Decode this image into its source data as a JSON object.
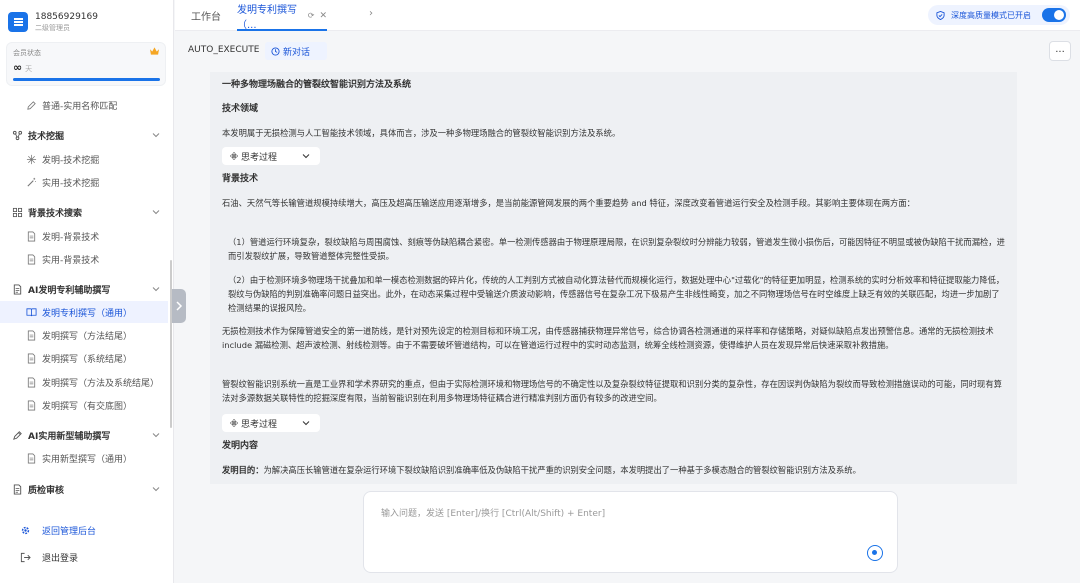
{
  "user": {
    "phone": "18856929169",
    "role": "二级管理员"
  },
  "member": {
    "label": "会员状态",
    "value": "∞",
    "unit": "天",
    "progress": 1.0
  },
  "nav": {
    "items": [
      {
        "type": "s",
        "label": "普通-实用名称匹配",
        "icon": "pencil-icon",
        "name": "sidebar-item-name-match"
      },
      {
        "type": "g",
        "label": "技术挖掘",
        "icon": "network-icon",
        "name": "sidebar-group-tech-mining",
        "chevron": true
      },
      {
        "type": "s",
        "label": "发明-技术挖掘",
        "icon": "sparkle-icon",
        "name": "sidebar-item-invention-mining"
      },
      {
        "type": "s",
        "label": "实用-技术挖掘",
        "icon": "wand-icon",
        "name": "sidebar-item-utility-mining"
      },
      {
        "type": "g",
        "label": "背景技术搜索",
        "icon": "grid-icon",
        "name": "sidebar-group-background",
        "chevron": true
      },
      {
        "type": "s",
        "label": "发明-背景技术",
        "icon": "document-icon",
        "name": "sidebar-item-invention-background"
      },
      {
        "type": "s",
        "label": "实用-背景技术",
        "icon": "document-icon",
        "name": "sidebar-item-utility-background"
      },
      {
        "type": "g",
        "label": "AI发明专利辅助撰写",
        "icon": "file-icon",
        "name": "sidebar-group-ai-invention",
        "chevron": true
      },
      {
        "type": "s",
        "label": "发明专利撰写（通用）",
        "icon": "book-icon",
        "name": "sidebar-item-invention-general",
        "active": true
      },
      {
        "type": "s",
        "label": "发明撰写（方法结尾）",
        "icon": "document-icon",
        "name": "sidebar-item-invention-method"
      },
      {
        "type": "s",
        "label": "发明撰写（系统结尾）",
        "icon": "document-icon",
        "name": "sidebar-item-invention-system"
      },
      {
        "type": "s",
        "label": "发明撰写（方法及系统结尾）",
        "icon": "document-icon",
        "name": "sidebar-item-invention-method-system"
      },
      {
        "type": "s",
        "label": "发明撰写（有交底图）",
        "icon": "document-icon",
        "name": "sidebar-item-invention-diagram"
      },
      {
        "type": "g",
        "label": "AI实用新型辅助撰写",
        "icon": "pen-icon",
        "name": "sidebar-group-ai-utility",
        "chevron": true
      },
      {
        "type": "s",
        "label": "实用新型撰写（通用）",
        "icon": "document-icon",
        "name": "sidebar-item-utility-general"
      },
      {
        "type": "g",
        "label": "质检审核",
        "icon": "file-icon",
        "name": "sidebar-group-quality",
        "chevron": true
      }
    ]
  },
  "bottom": {
    "admin": "返回管理后台",
    "logout": "退出登录"
  },
  "topbar": {
    "tab_home": "工作台",
    "tab_active": "发明专利撰写（...",
    "deep_mode": "深度高质量模式已开启"
  },
  "toolbar": {
    "mode": "AUTO_EXECUTE",
    "new_chat": "新对话",
    "more": "..."
  },
  "doc": {
    "title": "一种多物理场融合的管裂纹智能识别方法及系统",
    "h_field": "技术领域",
    "field": "本发明属于无损检测与人工智能技术领域，具体而言，涉及一种多物理场融合的管裂纹智能识别方法及系统。",
    "thinking": "思考过程",
    "h_background": "背景技术",
    "bg1": "石油、天然气等长输管道规模持续增大，高压及超高压输送应用逐渐增多，是当前能源管网发展的两个重要趋势 and 特征，深度改变着管道运行安全及检测手段。其影响主要体现在两方面：",
    "bg2": "（1）管道运行环境复杂，裂纹缺陷与周围腐蚀、刻痕等伪缺陷耦合紧密。单一检测传感器由于物理原理局限，在识别复杂裂纹时分辨能力较弱，管道发生微小损伤后，可能因特征不明显或被伪缺陷干扰而漏检，进而引发裂纹扩展，导致管道整体完整性受损。",
    "bg3": "（2）由于检测环境多物理场干扰叠加和单一模态检测数据的碎片化，传统的人工判别方式被自动化算法替代而规模化运行，数据处理中心\"过载化\"的特征更加明显，检测系统的实时分析效率和特征提取能力降低，裂纹与伪缺陷的判别准确率问题日益突出。此外，在动态采集过程中受输送介质波动影响，传感器信号在复杂工况下极易产生非线性畸变，加之不同物理场信号在时空维度上缺乏有效的关联匹配，均进一步加剧了检测结果的误报风险。",
    "bg4": "无损检测技术作为保障管道安全的第一道防线，是针对预先设定的检测目标和环境工况，由传感器捕获物理异常信号，综合协调各检测通道的采样率和存储策略，对疑似缺陷点发出预警信息。通常的无损检测技术 include 漏磁检测、超声波检测、射线检测等。由于不需要破坏管道结构，可以在管道运行过程中的实时动态监测，统筹全线检测资源，使得维护人员在发现异常后快速采取补救措施。",
    "bg5": "管裂纹智能识别系统一直是工业界和学术界研究的重点，但由于实际检测环境和物理场信号的不确定性以及复杂裂纹特征提取和识别分类的复杂性，存在因误判伪缺陷为裂纹而导致检测措施误动的可能，同时现有算法对多源数据关联特性的挖掘深度有限，当前智能识别在利用多物理场特征耦合进行精准判别方面仍有较多的改进空间。",
    "h_content": "发明内容",
    "purpose_label": "发明目的：",
    "purpose": "为解决高压长输管道在复杂运行环境下裂纹缺陷识别准确率低及伪缺陷干扰严重的识别安全问题，本发明提出了一种基于多模态融合的管裂纹智能识别方法及系统。"
  },
  "input": {
    "placeholder": "输入问题，发送 [Enter]/换行 [Ctrl(Alt/Shift) + Enter]"
  },
  "colors": {
    "accent": "#1a73e8",
    "active_bg": "#eef2ff"
  }
}
